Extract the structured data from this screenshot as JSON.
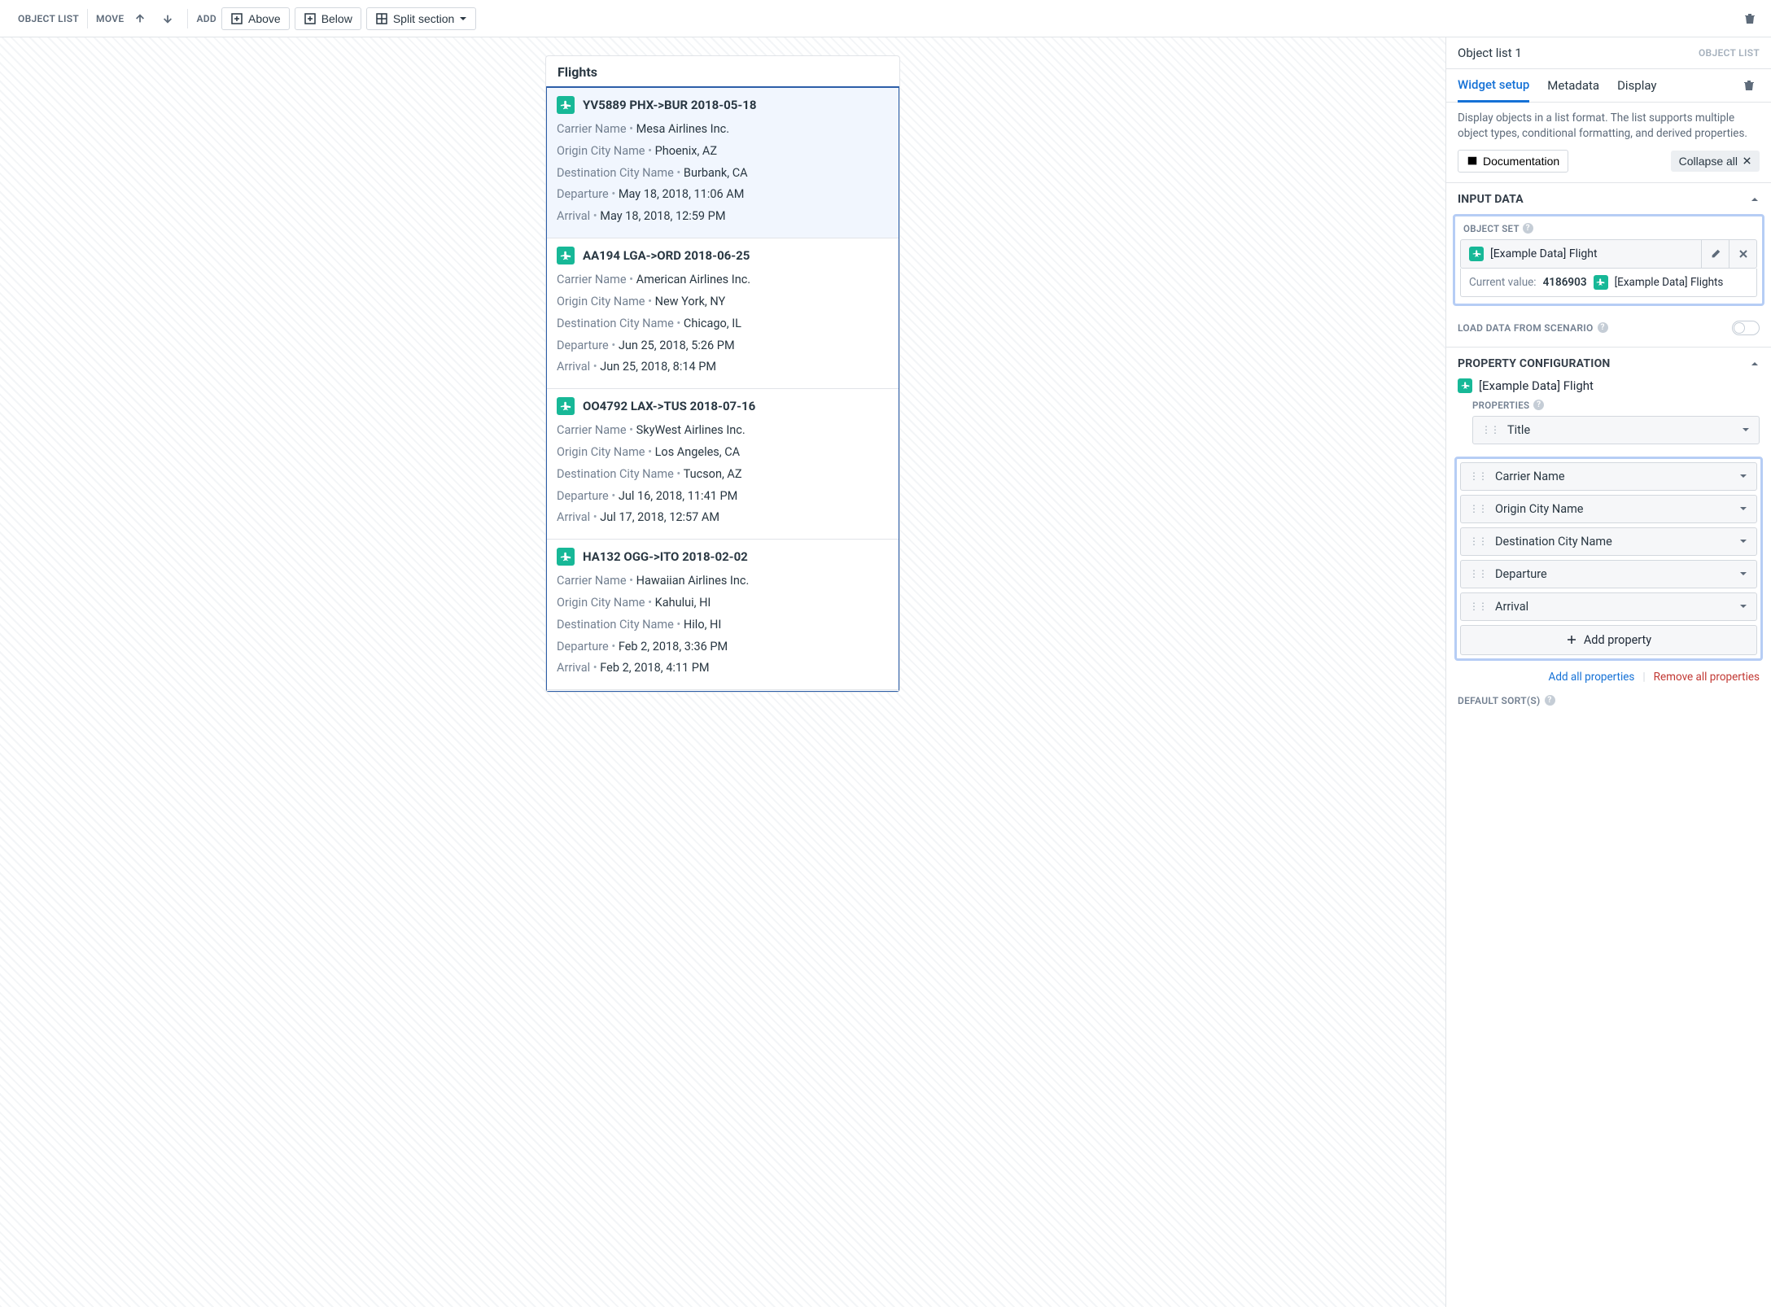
{
  "toolbar": {
    "object_list": "OBJECT LIST",
    "move": "MOVE",
    "add": "ADD",
    "above": "Above",
    "below": "Below",
    "split_section": "Split section"
  },
  "widget": {
    "title": "Flights",
    "props": [
      "Carrier Name",
      "Origin City Name",
      "Destination City Name",
      "Departure",
      "Arrival"
    ],
    "flights": [
      {
        "title": "YV5889 PHX->BUR 2018-05-18",
        "values": [
          "Mesa Airlines Inc.",
          "Phoenix, AZ",
          "Burbank, CA",
          "May 18, 2018, 11:06 AM",
          "May 18, 2018, 12:59 PM"
        ],
        "selected": true
      },
      {
        "title": "AA194 LGA->ORD 2018-06-25",
        "values": [
          "American Airlines Inc.",
          "New York, NY",
          "Chicago, IL",
          "Jun 25, 2018, 5:26 PM",
          "Jun 25, 2018, 8:14 PM"
        ],
        "selected": false
      },
      {
        "title": "OO4792 LAX->TUS 2018-07-16",
        "values": [
          "SkyWest Airlines Inc.",
          "Los Angeles, CA",
          "Tucson, AZ",
          "Jul 16, 2018, 11:41 PM",
          "Jul 17, 2018, 12:57 AM"
        ],
        "selected": false
      },
      {
        "title": "HA132 OGG->ITO 2018-02-02",
        "values": [
          "Hawaiian Airlines Inc.",
          "Kahului, HI",
          "Hilo, HI",
          "Feb 2, 2018, 3:36 PM",
          "Feb 2, 2018, 4:11 PM"
        ],
        "selected": false
      }
    ]
  },
  "sidebar": {
    "title": "Object list 1",
    "type": "OBJECT LIST",
    "tabs": [
      "Widget setup",
      "Metadata",
      "Display"
    ],
    "description": "Display objects in a list format. The list supports multiple object types, conditional formatting, and derived properties.",
    "documentation": "Documentation",
    "collapse_all": "Collapse all",
    "sections": {
      "input_data": "INPUT DATA",
      "object_set": "OBJECT SET",
      "object_set_value": "[Example Data] Flight",
      "current_value_label": "Current value:",
      "current_value_count": "4186903",
      "current_value_name": "[Example Data] Flights",
      "load_scenario": "LOAD DATA FROM SCENARIO",
      "prop_config": "PROPERTY CONFIGURATION",
      "example_flight": "[Example Data] Flight",
      "properties_label": "PROPERTIES",
      "title_prop": "Title",
      "props": [
        "Carrier Name",
        "Origin City Name",
        "Destination City Name",
        "Departure",
        "Arrival"
      ],
      "add_property": "Add property",
      "add_all": "Add all properties",
      "remove_all": "Remove all properties",
      "default_sort": "DEFAULT SORT(S)"
    }
  }
}
